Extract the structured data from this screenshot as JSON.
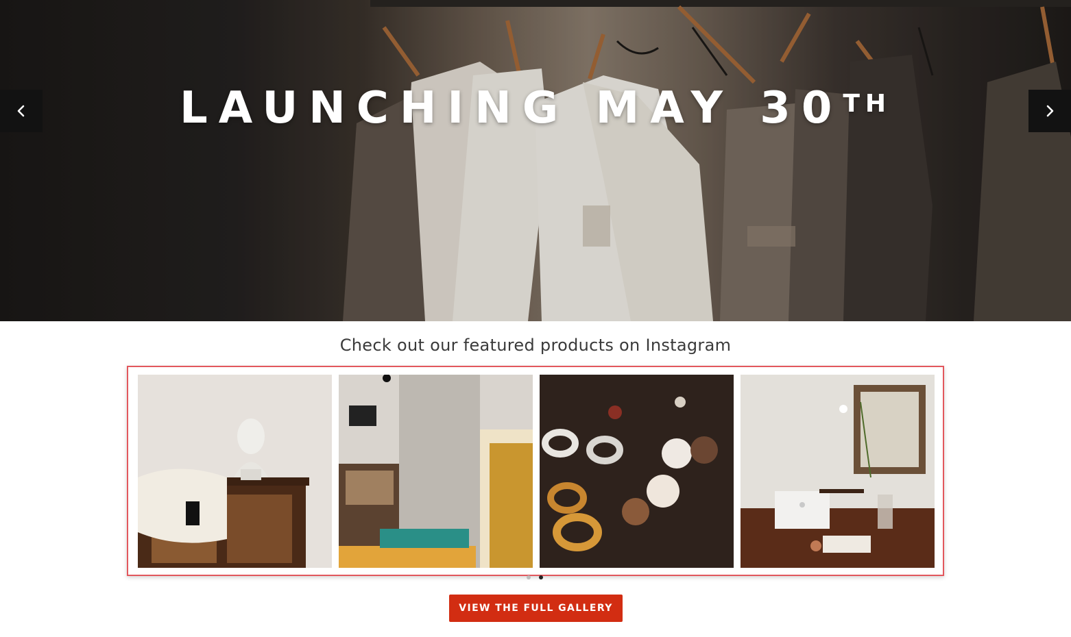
{
  "hero": {
    "title": "LAUNCHING MAY 30",
    "title_suffix": "TH",
    "prev_icon": "chevron-left-icon",
    "next_icon": "chevron-right-icon"
  },
  "instagram": {
    "heading": "Check out our featured products on Instagram",
    "slide_count": 2,
    "active_slide": 2
  },
  "cta": {
    "label": "VIEW THE FULL GALLERY"
  },
  "colors": {
    "accent": "#d22d12",
    "highlight_border": "#e2575d"
  }
}
